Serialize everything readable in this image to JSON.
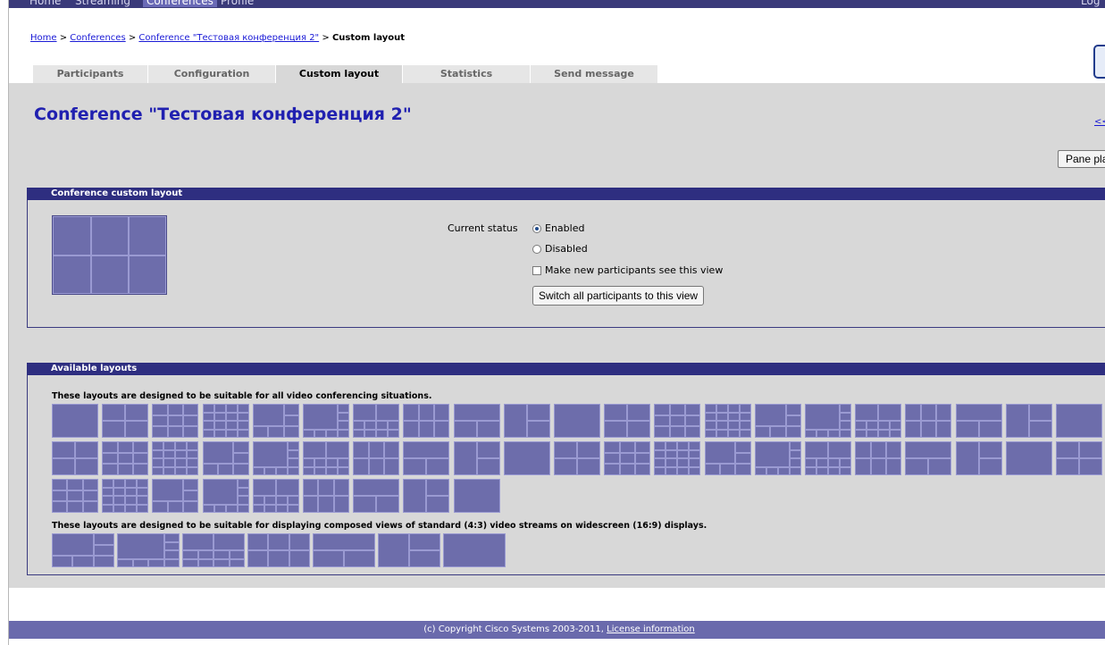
{
  "nav": {
    "items": [
      "Home",
      "Streaming",
      "Conferences",
      "Profile"
    ],
    "active": "Conferences",
    "logout": "Log ou"
  },
  "breadcrumb": {
    "home": "Home",
    "sep": ">",
    "conferences": "Conferences",
    "conference": "Conference \"Тестовая конференция 2\"",
    "current": "Custom layout"
  },
  "tabs": [
    {
      "label": "Participants"
    },
    {
      "label": "Configuration"
    },
    {
      "label": "Custom layout",
      "active": true
    },
    {
      "label": "Statistics"
    },
    {
      "label": "Send message"
    }
  ],
  "page": {
    "title": "Conference \"Тестовая конференция 2\"",
    "back_link": "<<",
    "pane_button": "Pane pla"
  },
  "custom_layout": {
    "header": "Conference custom layout",
    "status_label": "Current status",
    "enabled": "Enabled",
    "disabled": "Disabled",
    "selected": "Enabled",
    "new_participants_label": "Make new participants see this view",
    "new_participants_checked": false,
    "switch_button": "Switch all participants to this view"
  },
  "available": {
    "header": "Available layouts",
    "note_standard": "These layouts are designed to be suitable for all video conferencing situations.",
    "note_widescreen": "These layouts are designed to be suitable for displaying composed views of standard (4:3) video streams on widescreen (16:9) displays.",
    "standard_layout_count": 51,
    "widescreen_layout_count": 7
  },
  "footer": {
    "copyright": "(c) Copyright Cisco Systems 2003-2011,",
    "license": "License information"
  },
  "colors": {
    "header_bar": "#2e2e80",
    "content_bg": "#d8d8d8",
    "thumb": "#6d6dab",
    "link": "#1a1ad6",
    "title": "#2020b0"
  }
}
